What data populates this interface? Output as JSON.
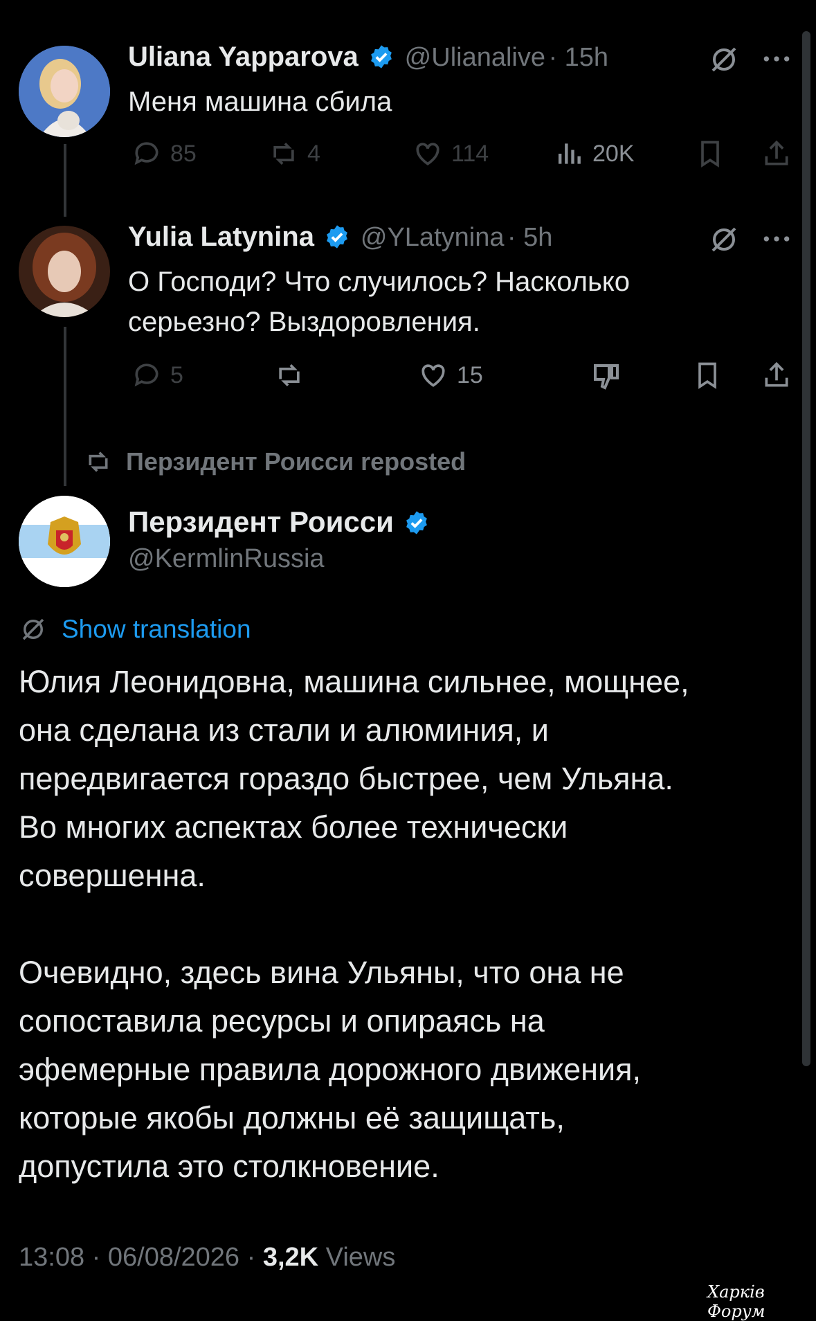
{
  "tweets": [
    {
      "name": "Uliana Yapparova",
      "handle": "@Ulianalive",
      "time": "· 15h",
      "text": "Меня машина сбила",
      "replies": "85",
      "reposts": "4",
      "likes": "114",
      "views": "20K"
    },
    {
      "name": "Yulia Latynina",
      "handle": "@YLatynina",
      "time": "· 5h",
      "text_line1": "О Господи? Что случилось? Насколько",
      "text_line2": "серьезно? Выздоровления.",
      "replies": "5",
      "likes": "15"
    }
  ],
  "repost_label": "Перзидент Роисси reposted",
  "main": {
    "name": "Перзидент Роисси",
    "handle": "@KermlinRussia",
    "show_translation": "Show translation",
    "p1": [
      "Юлия Леонидовна, машина сильнее, мощнее,",
      "она сделана из стали и алюминия, и",
      "передвигается гораздо быстрее, чем Ульяна.",
      "Во многих аспектах более технически",
      "совершенна."
    ],
    "p2": [
      "Очевидно, здесь вина Ульяны, что она не",
      "сопоставила ресурсы и опираясь на",
      "эфемерные правила дорожного движения,",
      "которые якобы должны её защищать,",
      "допустила это столкновение."
    ],
    "time": "13:08 · 06/08/2026 ·",
    "views_count": "3,2K",
    "views_label": "Views"
  },
  "watermark": "Харків Форум",
  "colors": {
    "accent": "#1d9bf0",
    "muted": "#71767b",
    "background": "#000000"
  },
  "icons": [
    "verified-badge-icon",
    "grok-icon",
    "more-icon",
    "reply-icon",
    "repost-icon",
    "like-icon",
    "views-icon",
    "bookmark-icon",
    "share-icon",
    "translate-icon"
  ]
}
